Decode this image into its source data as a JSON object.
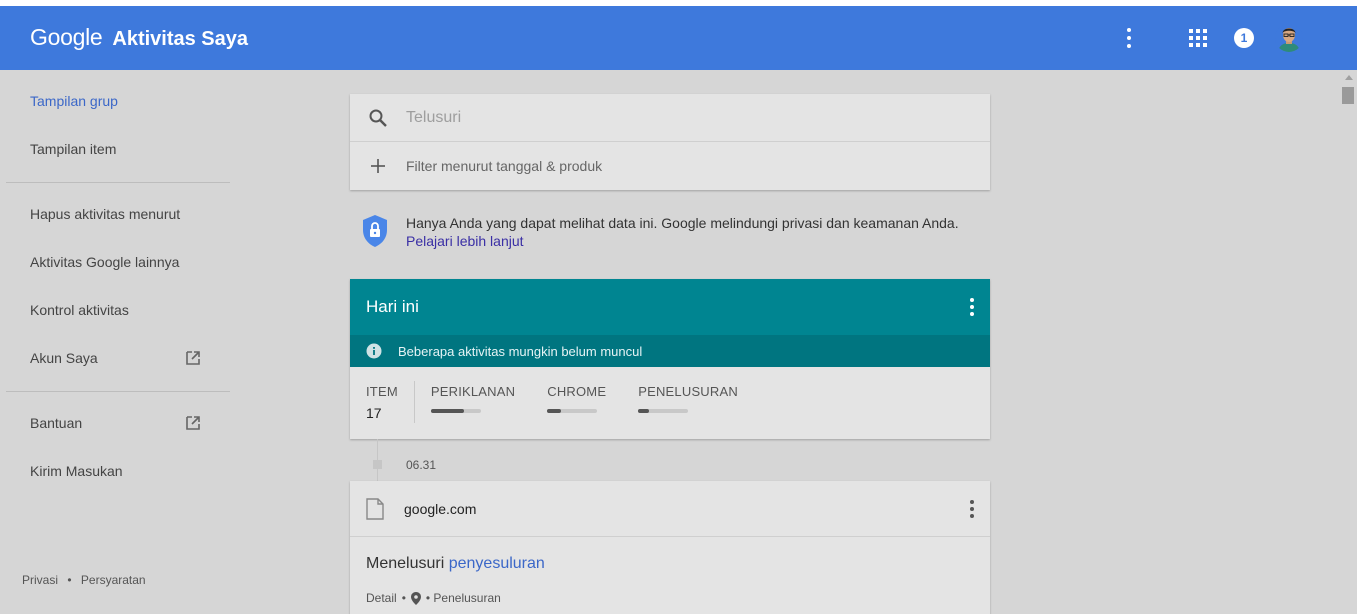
{
  "header": {
    "logo_text": "Google",
    "title": "Aktivitas Saya",
    "notification_count": "1",
    "bar_color": "#3e79dc"
  },
  "sidebar": {
    "items": [
      {
        "label": "Tampilan grup",
        "active": true
      },
      {
        "label": "Tampilan item"
      },
      {
        "label": "Hapus aktivitas menurut"
      },
      {
        "label": "Aktivitas Google lainnya"
      },
      {
        "label": "Kontrol aktivitas"
      },
      {
        "label": "Akun Saya",
        "icon": "open-in-new-icon"
      },
      {
        "label": "Bantuan",
        "icon": "open-in-new-icon"
      },
      {
        "label": "Kirim Masukan"
      }
    ],
    "footer": {
      "privacy": "Privasi",
      "sep": "•",
      "terms": "Persyaratan"
    }
  },
  "search": {
    "placeholder": "Telusuri",
    "filter_label": "Filter menurut tanggal & produk"
  },
  "privacy_notice": {
    "text": "Hanya Anda yang dapat melihat data ini. Google melindungi privasi dan keamanan Anda.",
    "link": "Pelajari lebih lanjut"
  },
  "today_card": {
    "title": "Hari ini",
    "notice": "Beberapa aktivitas mungkin belum muncul",
    "header_color": "#008591",
    "stats": {
      "item_label": "ITEM",
      "item_count": "17",
      "bars": [
        {
          "label": "PERIKLANAN",
          "fill": 0.66
        },
        {
          "label": "CHROME",
          "fill": 0.28
        },
        {
          "label": "PENELUSURAN",
          "fill": 0.22
        }
      ]
    }
  },
  "timeline": {
    "time": "06.31"
  },
  "entry": {
    "site": "google.com",
    "title_prefix": "Menelusuri",
    "query": "penyesuluran",
    "meta_detail": "Detail",
    "meta_dot": "•",
    "meta_product": "• Penelusuran"
  }
}
